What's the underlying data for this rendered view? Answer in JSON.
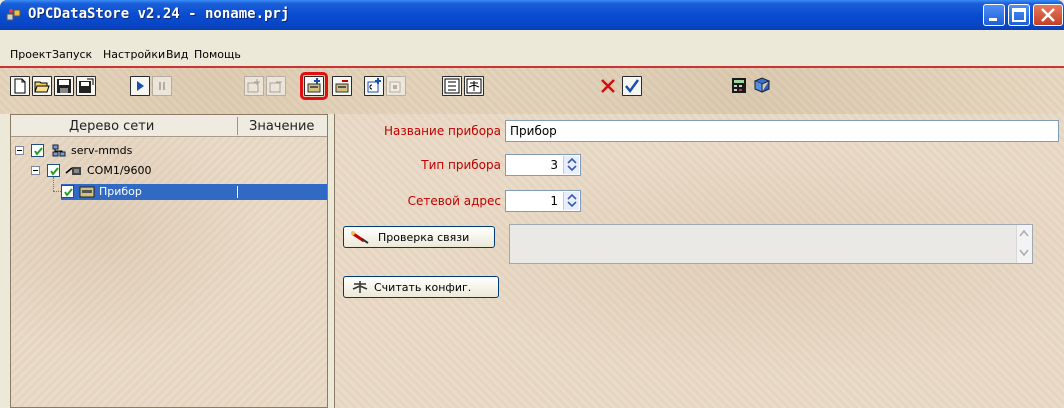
{
  "window": {
    "title": "OPCDataStore v2.24 - noname.prj"
  },
  "menu": [
    "Проект",
    "Запуск",
    "Настройки",
    "Вид",
    "Помощь"
  ],
  "toolbar": {
    "buttons": [
      {
        "icon": "new-file-icon",
        "state": "enabled"
      },
      {
        "icon": "open-folder-icon",
        "state": "enabled"
      },
      {
        "icon": "save-icon",
        "state": "enabled"
      },
      {
        "icon": "save-as-icon",
        "state": "enabled"
      },
      {
        "icon": "play-icon",
        "state": "enabled"
      },
      {
        "icon": "pause-icon",
        "state": "disabled"
      },
      {
        "icon": "add-port-icon",
        "state": "disabled"
      },
      {
        "icon": "remove-port-icon",
        "state": "disabled"
      },
      {
        "icon": "add-device-icon",
        "state": "selected"
      },
      {
        "icon": "remove-device-icon",
        "state": "enabled"
      },
      {
        "icon": "add-tag-icon",
        "state": "enabled"
      },
      {
        "icon": "remove-tag-icon",
        "state": "disabled"
      },
      {
        "icon": "list-view-icon",
        "state": "enabled"
      },
      {
        "icon": "config-view-icon",
        "state": "enabled"
      },
      {
        "icon": "cancel-x-icon",
        "state": "enabled"
      },
      {
        "icon": "apply-check-icon",
        "state": "enabled"
      },
      {
        "icon": "calculator-icon",
        "state": "enabled"
      },
      {
        "icon": "help-book-icon",
        "state": "enabled"
      }
    ],
    "accent_color": "#cc3333",
    "selected_outline_color": "#e01010"
  },
  "tree": {
    "columns": [
      "Дерево сети",
      "Значение"
    ],
    "nodes": [
      {
        "label": "serv-mmds",
        "level": 0,
        "checked": true,
        "icon": "network-server-icon"
      },
      {
        "label": "COM1/9600",
        "level": 1,
        "checked": true,
        "icon": "serial-port-icon"
      },
      {
        "label": "Прибор",
        "level": 2,
        "checked": true,
        "icon": "device-icon",
        "selected": true
      }
    ],
    "selection_color": "#316ac5"
  },
  "form": {
    "device_name_label": "Название прибора",
    "device_name_value": "Прибор",
    "device_type_label": "Тип прибора",
    "device_type_value": "3",
    "network_address_label": "Сетевой адрес",
    "network_address_value": "1",
    "check_connection_button": "Проверка связи",
    "read_config_button": "Считать конфиг.",
    "label_color": "#c00000"
  }
}
